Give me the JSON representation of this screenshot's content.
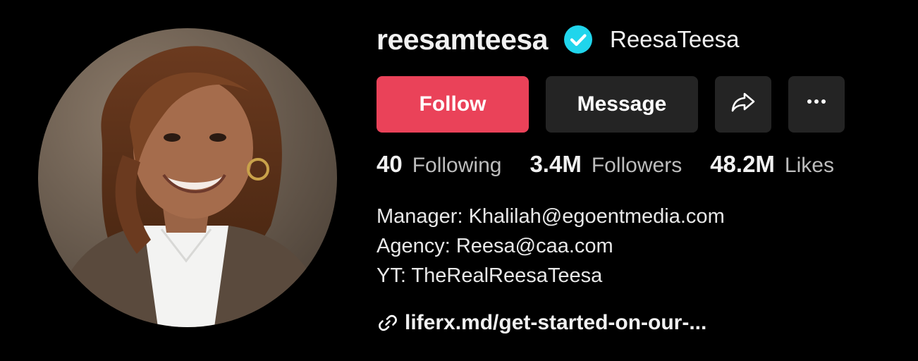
{
  "profile": {
    "username": "reesamteesa",
    "nickname": "ReesaTeesa",
    "verified": true
  },
  "actions": {
    "follow_label": "Follow",
    "message_label": "Message",
    "share_icon": "share-icon",
    "more_icon": "more-icon"
  },
  "stats": {
    "following_count": "40",
    "following_label": "Following",
    "followers_count": "3.4M",
    "followers_label": "Followers",
    "likes_count": "48.2M",
    "likes_label": "Likes"
  },
  "bio": {
    "lines": [
      "Manager: Khalilah@egoentmedia.com",
      "Agency: Reesa@caa.com",
      "YT: TheRealReesaTeesa"
    ]
  },
  "link": {
    "icon": "link-icon",
    "text": "liferx.md/get-started-on-our-..."
  },
  "colors": {
    "background": "#000000",
    "follow_button": "#ea4259",
    "secondary_button": "#242424",
    "verified_badge": "#20d5ec"
  }
}
